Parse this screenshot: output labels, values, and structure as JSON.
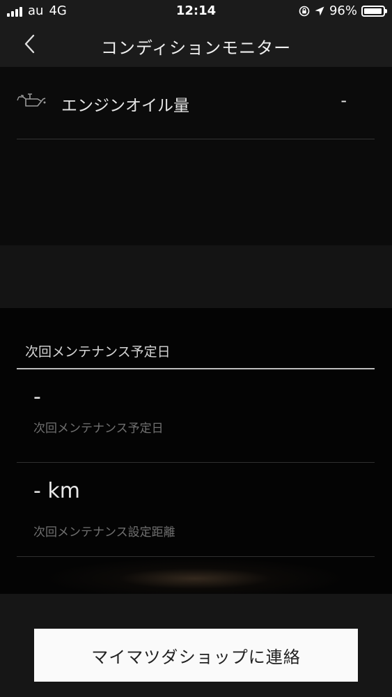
{
  "status_bar": {
    "carrier": "au",
    "network": "4G",
    "time": "12:14",
    "battery_percent": "96%",
    "battery_level": 0.96
  },
  "nav": {
    "title": "コンディションモニター"
  },
  "oil": {
    "label": "エンジンオイル量",
    "value": "-"
  },
  "maintenance": {
    "header": "次回メンテナンス予定日",
    "date_value": "-",
    "date_caption": "次回メンテナンス予定日",
    "distance_value": "- km",
    "distance_caption": "次回メンテナンス設定距離"
  },
  "footer": {
    "contact_label": "マイマツダショップに連絡"
  },
  "colors": {
    "background": "#050505",
    "bar": "#1b1b1b",
    "button": "#fafafa"
  }
}
